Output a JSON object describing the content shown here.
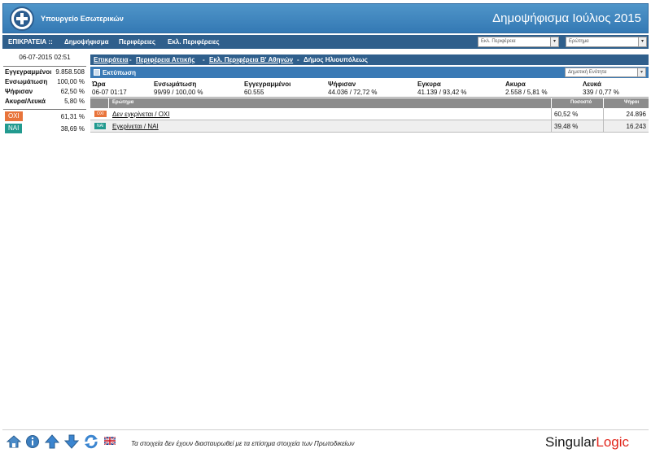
{
  "header": {
    "ministry": "Υπουργείο Εσωτερικών",
    "title": "Δημοψήφισμα Ιούλιος 2015"
  },
  "nav": {
    "items": [
      "ΕΠΙΚΡΑΤΕΙΑ ::",
      "Δημοψήφισμα",
      "Περιφέρειες",
      "Εκλ. Περιφέρειες"
    ],
    "select_region": "Εκλ. Περιφέρεια",
    "select_question": "Ερώτημα"
  },
  "left": {
    "datetime": "06-07-2015 02:51",
    "stats": [
      {
        "label": "Εγγεγραμμένοι",
        "value": "9.858.508"
      },
      {
        "label": "Ενσωμάτωση",
        "value": "100,00 %"
      },
      {
        "label": "Ψήφισαν",
        "value": "62,50 %"
      },
      {
        "label": "Ακυρα/Λευκά",
        "value": "5,80 %"
      }
    ],
    "votes": [
      {
        "label": "ΟΧΙ",
        "value": "61,31 %",
        "color": "#e8743b"
      },
      {
        "label": "ΝΑΙ",
        "value": "38,69 %",
        "color": "#229a8f"
      }
    ]
  },
  "breadcrumb": {
    "items": [
      "Επικράτεια",
      "Περιφέρεια Αττικής",
      "Εκλ. Περιφέρεια Β' Αθηνών"
    ],
    "sep": "-",
    "current": "Δήμος Ηλιουπόλεως"
  },
  "toolbar": {
    "print_label": "Εκτύπωση",
    "unit_select": "Δημοτική Ενότητα"
  },
  "summary": {
    "headers": [
      "Ώρα",
      "Ενσωμάτωση",
      "Εγγεγραμμένοι",
      "Ψήφισαν",
      "Εγκυρα",
      "Ακυρα",
      "Λευκά"
    ],
    "values": [
      "06-07 01:17",
      "99/99 / 100,00 %",
      "60.555",
      "44.036 / 72,72 %",
      "41.139 / 93,42 %",
      "2.558 / 5,81 %",
      "339 / 0,77 %"
    ]
  },
  "results": {
    "headers": {
      "question": "Ερώτημα",
      "percent": "Ποσοστό",
      "votes": "Ψήφοι"
    },
    "rows": [
      {
        "badge": "ΟΧΙ",
        "badge_color": "#e8743b",
        "answer": "Δεν εγκρίνεται / ΟΧΙ",
        "percent": "60,52 %",
        "votes": "24.896"
      },
      {
        "badge": "ΝΑΙ",
        "badge_color": "#229a8f",
        "answer": "Εγκρίνεται / ΝΑΙ",
        "percent": "39,48 %",
        "votes": "16.243"
      }
    ]
  },
  "footer": {
    "icons": [
      "home-icon",
      "info-icon",
      "arrow-up-icon",
      "arrow-down-icon",
      "refresh-icon",
      "uk-flag-icon"
    ],
    "note": "Τα στοιχεία δεν έχουν διασταυρωθεί με τα επίσημα στοιχεία των Πρωτοδικείων",
    "logo_part1": "Singular",
    "logo_part2": "Logic"
  }
}
